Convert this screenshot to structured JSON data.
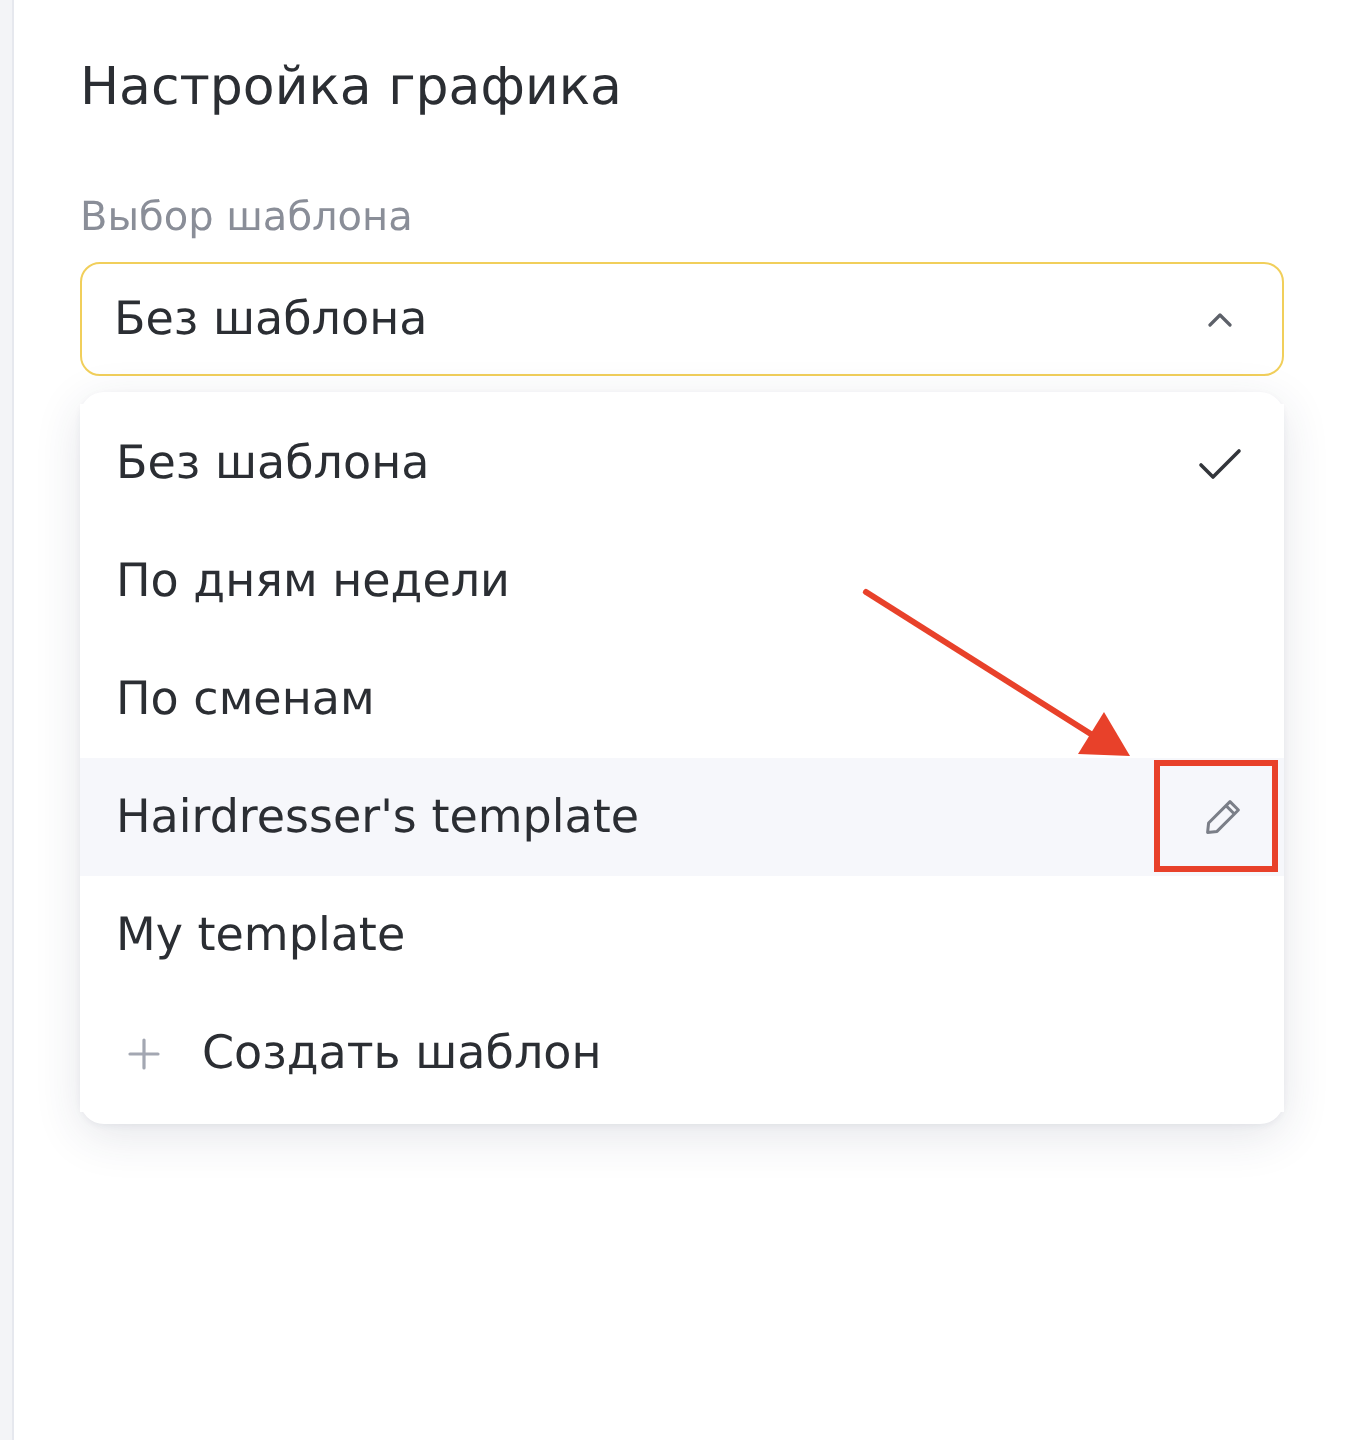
{
  "panel": {
    "title": "Настройка графика"
  },
  "template_select": {
    "label": "Выбор шаблона",
    "value": "Без шаблона",
    "expanded": true
  },
  "dropdown": {
    "items": [
      {
        "kind": "option",
        "label": "Без шаблона",
        "selected": true,
        "hovered": false
      },
      {
        "kind": "option",
        "label": "По дням недели",
        "selected": false,
        "hovered": false
      },
      {
        "kind": "option",
        "label": "По сменам",
        "selected": false,
        "hovered": false
      },
      {
        "kind": "option",
        "label": "Hairdresser's template",
        "selected": false,
        "hovered": true
      },
      {
        "kind": "option",
        "label": "My template",
        "selected": false,
        "hovered": false
      },
      {
        "kind": "create",
        "label": "Создать шаблон"
      }
    ]
  }
}
